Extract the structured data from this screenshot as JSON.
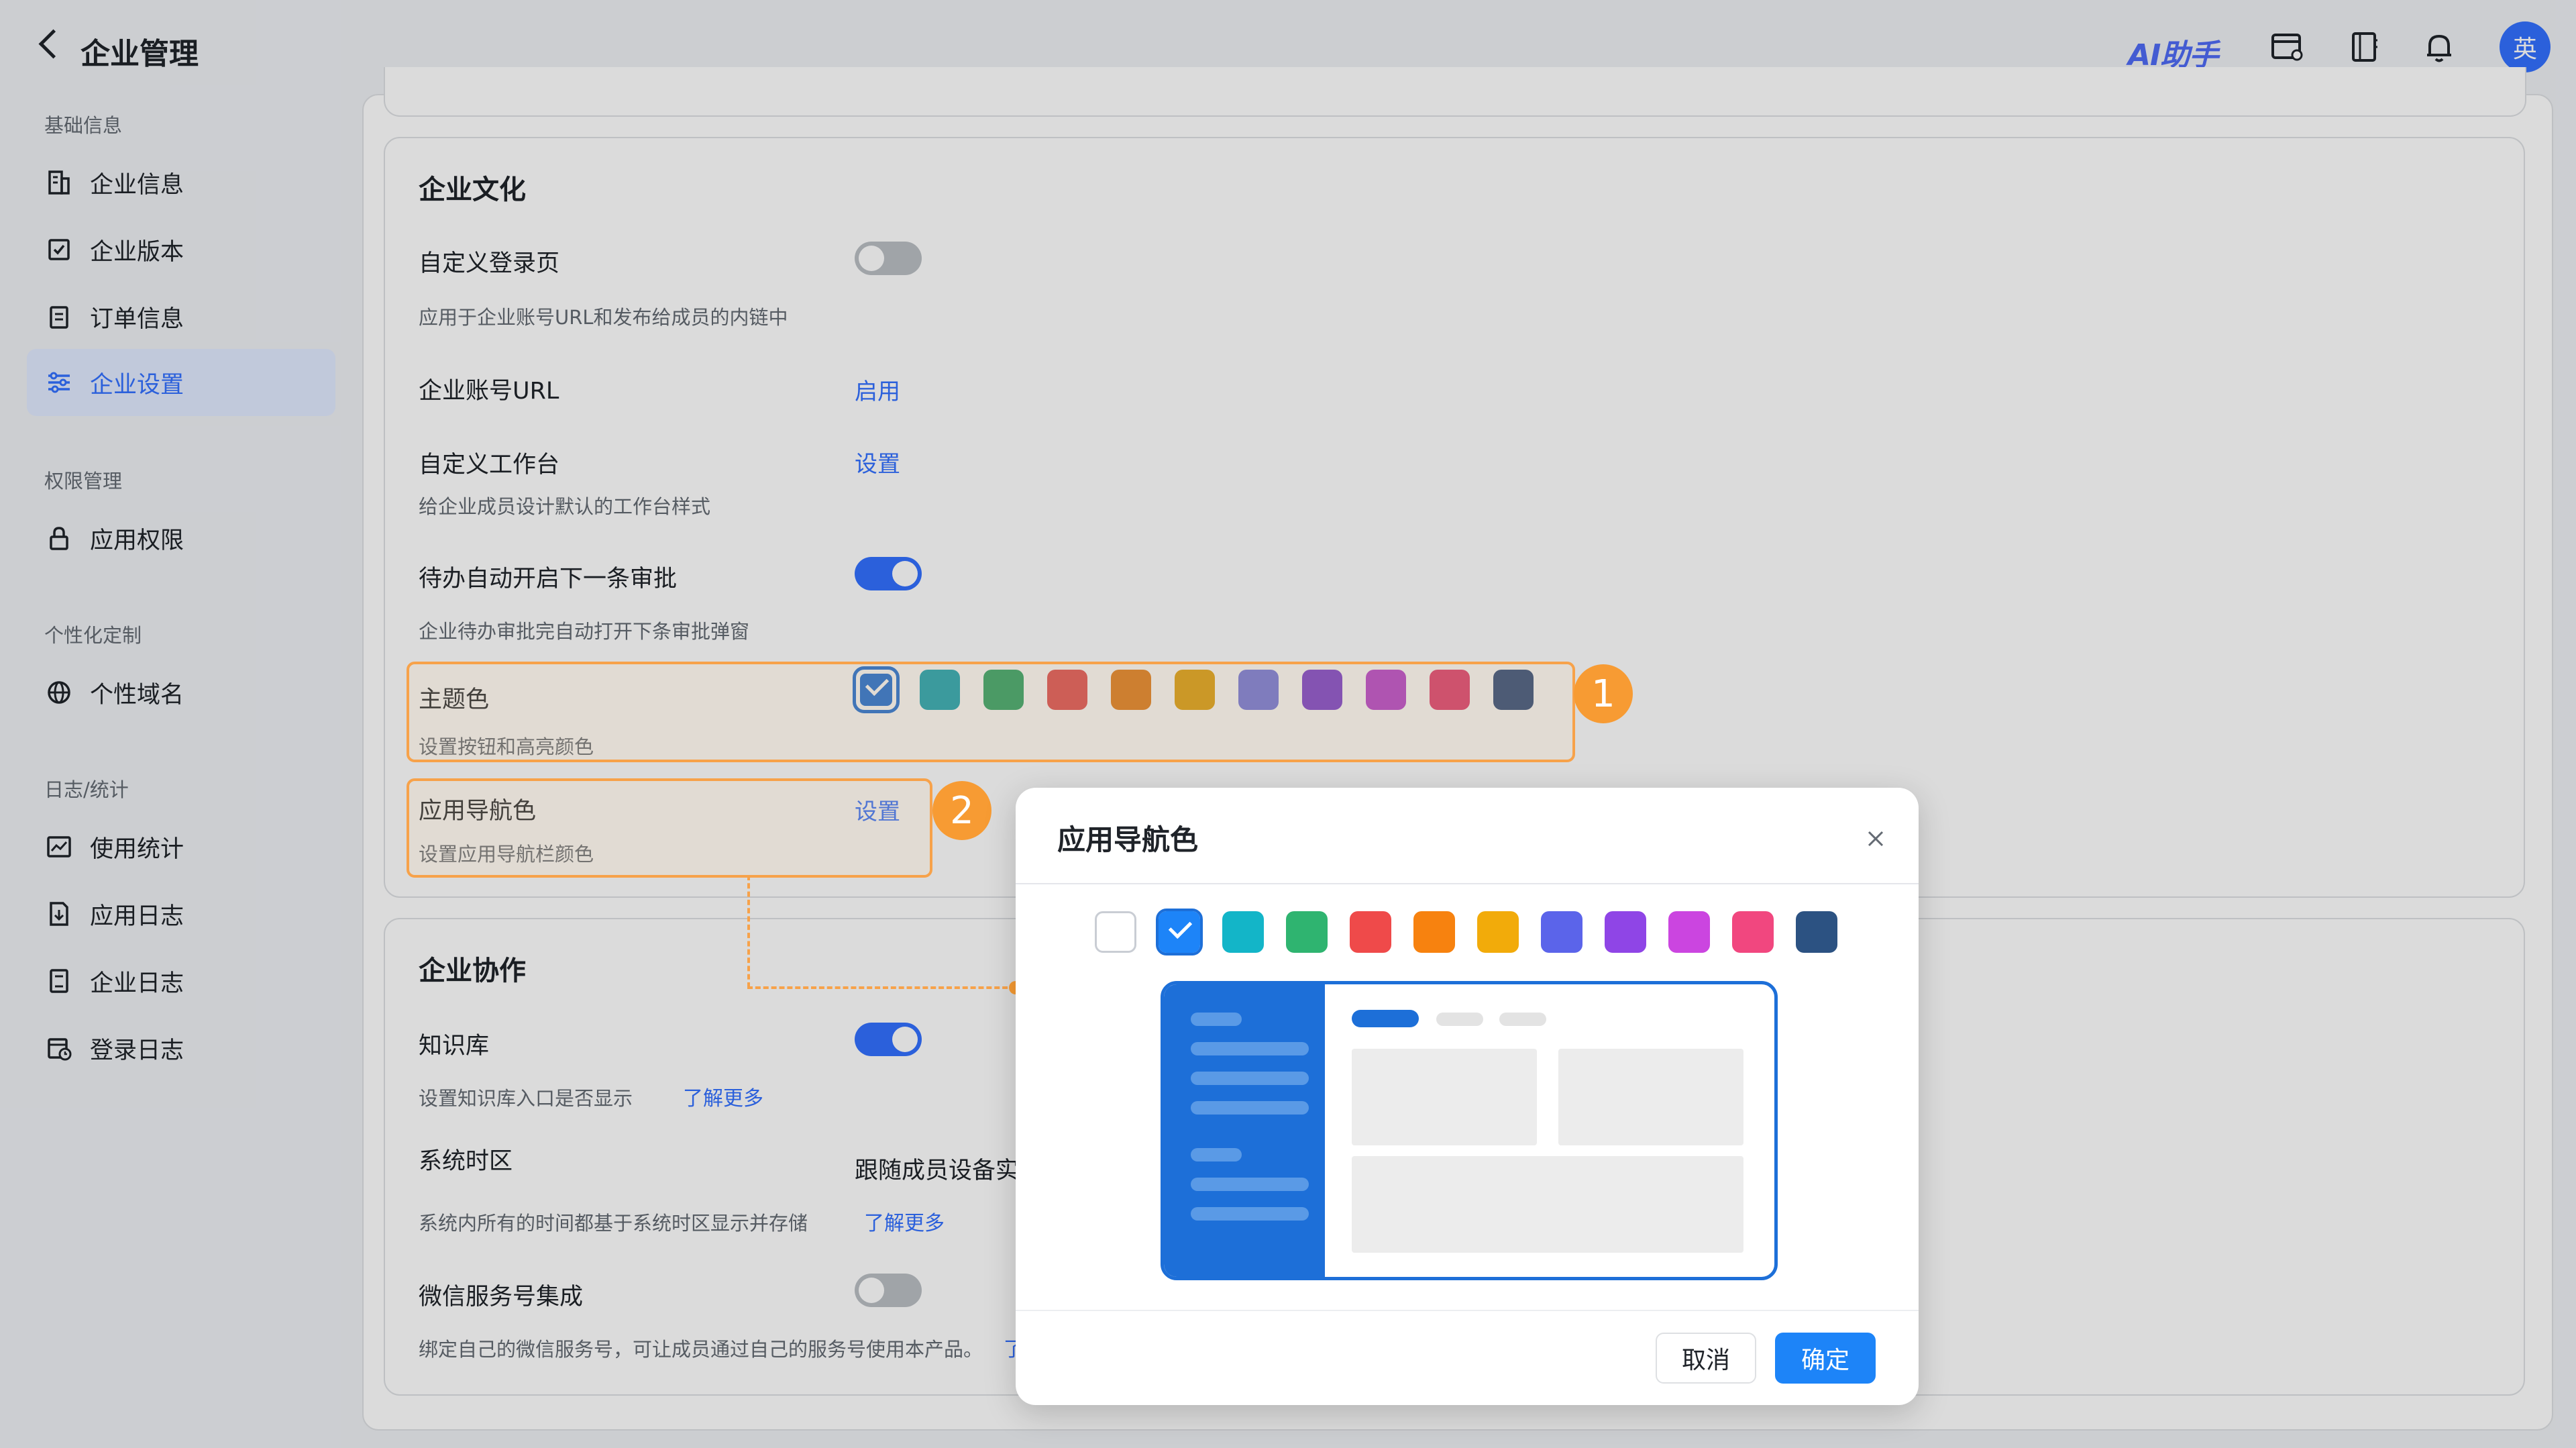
{
  "header": {
    "title": "企业管理",
    "ai_label": "AI助手",
    "avatar_text": "英"
  },
  "sidebar": {
    "groups": [
      {
        "label": "基础信息",
        "items": [
          "企业信息",
          "企业版本",
          "订单信息",
          "企业设置"
        ]
      },
      {
        "label": "权限管理",
        "items": [
          "应用权限"
        ]
      },
      {
        "label": "个性化定制",
        "items": [
          "个性域名"
        ]
      },
      {
        "label": "日志/统计",
        "items": [
          "使用统计",
          "应用日志",
          "企业日志",
          "登录日志"
        ]
      }
    ],
    "active_item": "企业设置"
  },
  "culture": {
    "title": "企业文化",
    "rows": [
      {
        "label": "自定义登录页",
        "desc": "应用于企业账号URL和发布给成员的内链中",
        "control": "switch",
        "on": false
      },
      {
        "label": "企业账号URL",
        "action": "启用"
      },
      {
        "label": "自定义工作台",
        "action": "设置",
        "desc": "给企业成员设计默认的工作台样式"
      },
      {
        "label": "待办自动开启下一条审批",
        "desc": "企业待办审批完自动打开下条审批弹窗",
        "control": "switch",
        "on": true
      },
      {
        "label": "主题色",
        "desc": "设置按钮和高亮颜色"
      },
      {
        "label": "应用导航色",
        "action": "设置",
        "desc": "设置应用导航栏颜色"
      }
    ],
    "theme_colors": [
      "#1d6fd8",
      "#13a3b3",
      "#2aa364",
      "#e34d4d",
      "#e37d18",
      "#e0a00b",
      "#7478e0",
      "#7b3ed1",
      "#b93fcf",
      "#e53d6e",
      "#2d4a7a"
    ],
    "theme_selected_index": 0
  },
  "collab": {
    "title": "企业协作",
    "rows": [
      {
        "label": "知识库",
        "desc": "设置知识库入口是否显示",
        "link": "了解更多",
        "control": "switch",
        "on": true
      },
      {
        "label": "系统时区",
        "value": "跟随成员设备实",
        "desc": "系统内所有的时间都基于系统时区显示并存储",
        "link": "了解更多"
      },
      {
        "label": "微信服务号集成",
        "desc": "绑定自己的微信服务号，可让成员通过自己的服务号使用本产品。",
        "link_cut": "了",
        "control": "switch",
        "on": false
      }
    ]
  },
  "annotations": {
    "badge1": "1",
    "badge2": "2"
  },
  "dialog": {
    "title": "应用导航色",
    "colors": [
      "#ffffff",
      "#1d84f8",
      "#13b5c8",
      "#2fb470",
      "#ef4a4a",
      "#f7820f",
      "#f2ab0a",
      "#5b64ea",
      "#8f45e6",
      "#cb45e0",
      "#f1477f",
      "#2c5282"
    ],
    "selected_index": 1,
    "cancel_label": "取消",
    "ok_label": "确定"
  }
}
